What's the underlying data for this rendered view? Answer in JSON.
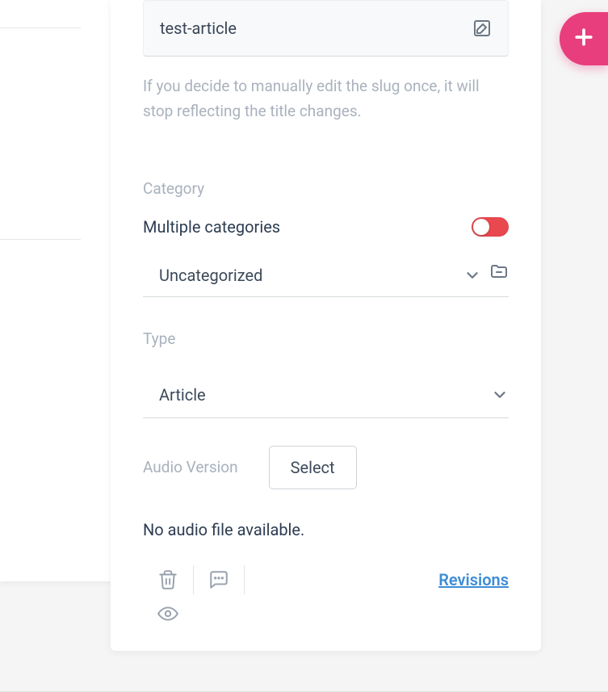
{
  "slug": {
    "value": "test-article",
    "hint": "If you decide to manually edit the slug once, it will stop reflecting the title changes."
  },
  "category": {
    "label": "Category",
    "multi_label": "Multiple categories",
    "multi_on": true,
    "selected": "Uncategorized"
  },
  "type": {
    "label": "Type",
    "selected": "Article"
  },
  "audio": {
    "label": "Audio Version",
    "select_button": "Select",
    "status": "No audio file available."
  },
  "footer": {
    "revisions": "Revisions"
  }
}
